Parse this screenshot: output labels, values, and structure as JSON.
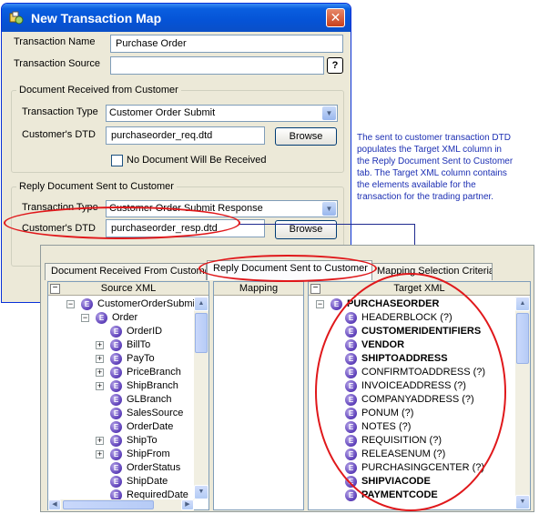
{
  "dialog": {
    "title": "New Transaction Map",
    "close_glyph": "✕",
    "transaction_name_label": "Transaction Name",
    "transaction_name_value": "Purchase Order",
    "transaction_source_label": "Transaction Source",
    "transaction_source_value": "",
    "help_button": "?",
    "received_group": {
      "title": "Document Received from Customer",
      "transaction_type_label": "Transaction Type",
      "transaction_type_value": "Customer Order Submit",
      "dtd_label": "Customer's DTD",
      "dtd_value": "purchaseorder_req.dtd",
      "browse_label": "Browse",
      "no_document_label": "No Document Will Be Received"
    },
    "reply_group": {
      "title": "Reply Document Sent to Customer",
      "transaction_type_label": "Transaction Type",
      "transaction_type_value": "Customer Order Submit Response",
      "dtd_label": "Customer's DTD",
      "dtd_value": "purchaseorder_resp.dtd",
      "browse_label": "Browse"
    }
  },
  "annotation": "The sent to customer transaction DTD populates the Target XML column in the Reply Document Sent to Customer tab. The Target XML column contains the elements available for the transaction for the trading partner.",
  "panel": {
    "tabs": [
      {
        "label": "Document Received From Customer"
      },
      {
        "label": "Reply Document Sent to Customer"
      },
      {
        "label": "Mapping Selection Criteria"
      }
    ],
    "source_header": "Source XML",
    "mapping_header": "Mapping",
    "target_header": "Target XML",
    "collapse_glyph": "−",
    "source_tree": [
      {
        "label": "CustomerOrderSubmit",
        "level": 0,
        "expander": "−"
      },
      {
        "label": "Order",
        "level": 1,
        "expander": "−"
      },
      {
        "label": "OrderID",
        "level": 2,
        "expander": ""
      },
      {
        "label": "BillTo",
        "level": 2,
        "expander": "+"
      },
      {
        "label": "PayTo",
        "level": 2,
        "expander": "+"
      },
      {
        "label": "PriceBranch",
        "level": 2,
        "expander": "+"
      },
      {
        "label": "ShipBranch",
        "level": 2,
        "expander": "+"
      },
      {
        "label": "GLBranch",
        "level": 2,
        "expander": ""
      },
      {
        "label": "SalesSource",
        "level": 2,
        "expander": ""
      },
      {
        "label": "OrderDate",
        "level": 2,
        "expander": ""
      },
      {
        "label": "ShipTo",
        "level": 2,
        "expander": "+"
      },
      {
        "label": "ShipFrom",
        "level": 2,
        "expander": "+"
      },
      {
        "label": "OrderStatus",
        "level": 2,
        "expander": ""
      },
      {
        "label": "ShipDate",
        "level": 2,
        "expander": ""
      },
      {
        "label": "RequiredDate",
        "level": 2,
        "expander": ""
      }
    ],
    "target_tree": [
      {
        "label": "PURCHASEORDER",
        "level": 0,
        "bold": true,
        "expander": "−"
      },
      {
        "label": "HEADERBLOCK (?)",
        "level": 1,
        "bold": false
      },
      {
        "label": "CUSTOMERIDENTIFIERS",
        "level": 1,
        "bold": true
      },
      {
        "label": "VENDOR",
        "level": 1,
        "bold": true
      },
      {
        "label": "SHIPTOADDRESS",
        "level": 1,
        "bold": true
      },
      {
        "label": "CONFIRMTOADDRESS (?)",
        "level": 1,
        "bold": false
      },
      {
        "label": "INVOICEADDRESS (?)",
        "level": 1,
        "bold": false
      },
      {
        "label": "COMPANYADDRESS (?)",
        "level": 1,
        "bold": false
      },
      {
        "label": "PONUM (?)",
        "level": 1,
        "bold": false
      },
      {
        "label": "NOTES (?)",
        "level": 1,
        "bold": false
      },
      {
        "label": "REQUISITION (?)",
        "level": 1,
        "bold": false
      },
      {
        "label": "RELEASENUM (?)",
        "level": 1,
        "bold": false
      },
      {
        "label": "PURCHASINGCENTER (?)",
        "level": 1,
        "bold": false
      },
      {
        "label": "SHIPVIACODE",
        "level": 1,
        "bold": true
      },
      {
        "label": "PAYMENTCODE",
        "level": 1,
        "bold": true
      }
    ]
  },
  "icons": {
    "element_glyph": "E",
    "arrow_up": "▲",
    "arrow_down": "▼",
    "arrow_left": "◀",
    "arrow_right": "▶"
  },
  "colors": {
    "highlight_red": "#e0181b",
    "annotation_blue": "#1c2fb3",
    "title_blue": "#0553d6"
  }
}
